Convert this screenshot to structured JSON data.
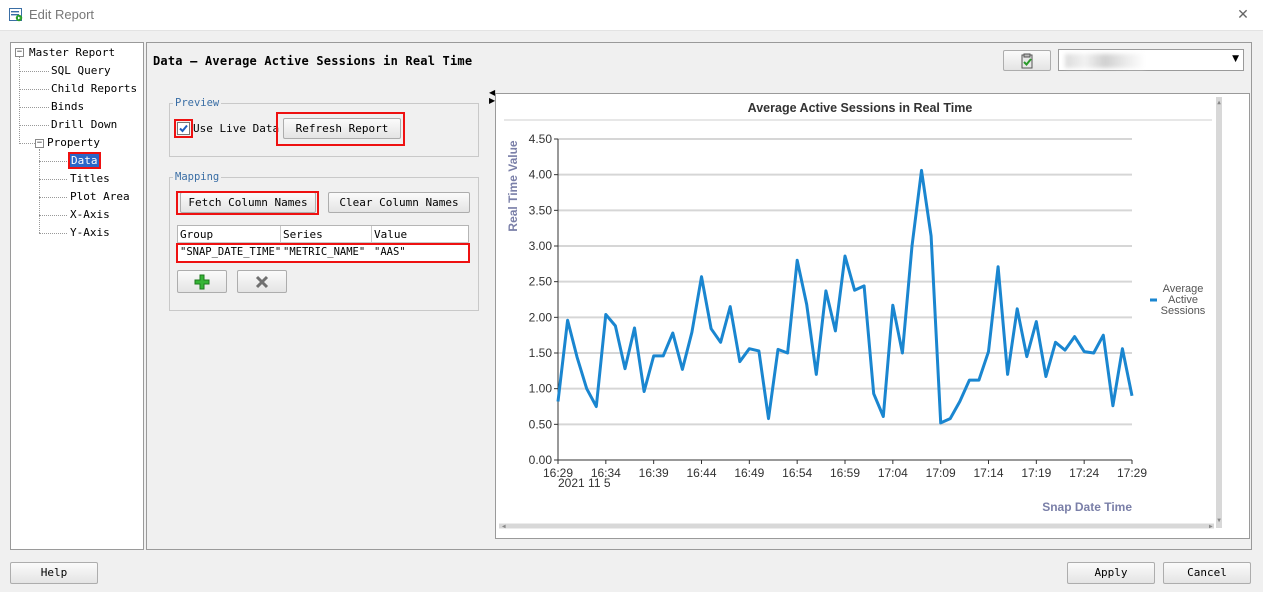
{
  "window": {
    "title": "Edit Report",
    "close_glyph": "✕"
  },
  "tree": {
    "root": "Master Report",
    "items": [
      "SQL Query",
      "Child Reports",
      "Binds",
      "Drill Down"
    ],
    "property": "Property",
    "property_items": [
      "Data",
      "Titles",
      "Plot Area",
      "X-Axis",
      "Y-Axis"
    ],
    "selected": "Data"
  },
  "panel": {
    "title": "Data — Average Active Sessions in Real Time",
    "preview": {
      "legend": "Preview",
      "use_live_data_label": "Use Live Data",
      "use_live_data_checked": true,
      "refresh_label": "Refresh Report"
    },
    "mapping": {
      "legend": "Mapping",
      "fetch_label": "Fetch Column Names",
      "clear_label": "Clear Column Names",
      "headers": [
        "Group",
        "Series",
        "Value"
      ],
      "row": [
        "\"SNAP_DATE_TIME\"",
        "\"METRIC_NAME\"",
        "\"AAS\""
      ],
      "add_icon": "plus-icon",
      "delete_icon": "x-icon"
    },
    "connection_combo_value": ""
  },
  "chart_data": {
    "type": "line",
    "title": "Average Active Sessions in Real Time",
    "xlabel": "Snap Date Time",
    "ylabel": "Real Time Value",
    "date_label": "2021 11 5",
    "x_ticks": [
      "16:29",
      "16:34",
      "16:39",
      "16:44",
      "16:49",
      "16:54",
      "16:59",
      "17:04",
      "17:09",
      "17:14",
      "17:19",
      "17:24",
      "17:29"
    ],
    "ylim": [
      0,
      4.5
    ],
    "y_ticks": [
      "0.00",
      "0.50",
      "1.00",
      "1.50",
      "2.00",
      "2.50",
      "3.00",
      "3.50",
      "4.00",
      "4.50"
    ],
    "legend_lines": [
      "Average",
      "Active",
      "Sessions"
    ],
    "legend_position": "right",
    "grid": true,
    "series": [
      {
        "name": "Average Active Sessions",
        "color": "#1a86d0",
        "x_minutes": [
          0,
          1,
          2,
          3,
          4,
          5,
          6,
          7,
          8,
          9,
          10,
          11,
          12,
          13,
          14,
          15,
          16,
          17,
          18,
          19,
          20,
          21,
          22,
          23,
          24,
          25,
          26,
          27,
          28,
          29,
          30,
          31,
          32,
          33,
          34,
          35,
          36,
          37,
          38,
          39,
          40,
          41,
          42,
          43,
          44,
          45,
          46,
          47,
          48,
          49,
          50,
          51,
          52,
          53,
          54,
          55,
          56,
          57,
          58,
          59,
          60
        ],
        "values": [
          0.82,
          1.96,
          1.44,
          1.0,
          0.75,
          2.04,
          1.88,
          1.28,
          1.85,
          0.96,
          1.46,
          1.46,
          1.78,
          1.27,
          1.79,
          2.57,
          1.84,
          1.65,
          2.15,
          1.38,
          1.56,
          1.53,
          0.58,
          1.55,
          1.5,
          2.8,
          2.18,
          1.2,
          2.37,
          1.81,
          2.86,
          2.38,
          2.44,
          0.93,
          0.61,
          2.17,
          1.5,
          3.0,
          4.06,
          3.14,
          0.52,
          0.58,
          0.82,
          1.12,
          1.12,
          1.52,
          2.71,
          1.2,
          2.12,
          1.45,
          1.94,
          1.17,
          1.65,
          1.54,
          1.73,
          1.52,
          1.5,
          1.75,
          0.76,
          1.56,
          0.9
        ]
      }
    ]
  }
}
